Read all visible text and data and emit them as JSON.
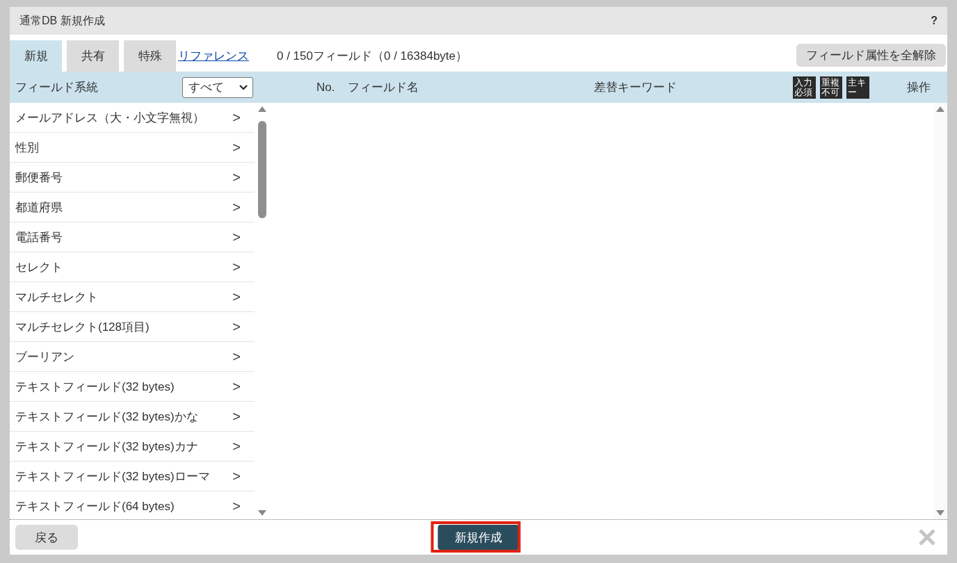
{
  "dialog": {
    "title": "通常DB 新規作成",
    "help": "?"
  },
  "tabs": [
    {
      "label": "新規",
      "selected": true
    },
    {
      "label": "共有",
      "selected": false
    },
    {
      "label": "特殊",
      "selected": false
    }
  ],
  "reference_link": "リファレンス",
  "field_count": "0 / 150フィールド（0 / 16384byte）",
  "clear_button": "フィールド属性を全解除",
  "category_header": {
    "label": "フィールド系統",
    "filter": "すべて"
  },
  "columns": {
    "no": "No.",
    "field_name": "フィールド名",
    "keyword": "差替キーワード",
    "flags": [
      "入力必須",
      "重複不可",
      "主キー"
    ],
    "actions": "操作"
  },
  "field_types": [
    {
      "label": "メールアドレス（大・小文字無視）",
      "arrow": ">"
    },
    {
      "label": "性別",
      "arrow": ">"
    },
    {
      "label": "郵便番号",
      "arrow": ">"
    },
    {
      "label": "都道府県",
      "arrow": ">"
    },
    {
      "label": "電話番号",
      "arrow": ">"
    },
    {
      "label": "セレクト",
      "arrow": ">"
    },
    {
      "label": "マルチセレクト",
      "arrow": ">"
    },
    {
      "label": "マルチセレクト(128項目)",
      "arrow": ">"
    },
    {
      "label": "ブーリアン",
      "arrow": ">"
    },
    {
      "label": "テキストフィールド(32 bytes)",
      "arrow": ">"
    },
    {
      "label": "テキストフィールド(32 bytes)かな",
      "arrow": ">"
    },
    {
      "label": "テキストフィールド(32 bytes)カナ",
      "arrow": ">"
    },
    {
      "label": "テキストフィールド(32 bytes)ローマ",
      "arrow": ">"
    },
    {
      "label": "テキストフィールド(64 bytes)",
      "arrow": ">"
    }
  ],
  "footer": {
    "back_button": "戻る",
    "create_button": "新規作成",
    "create_highlighted": true
  }
}
